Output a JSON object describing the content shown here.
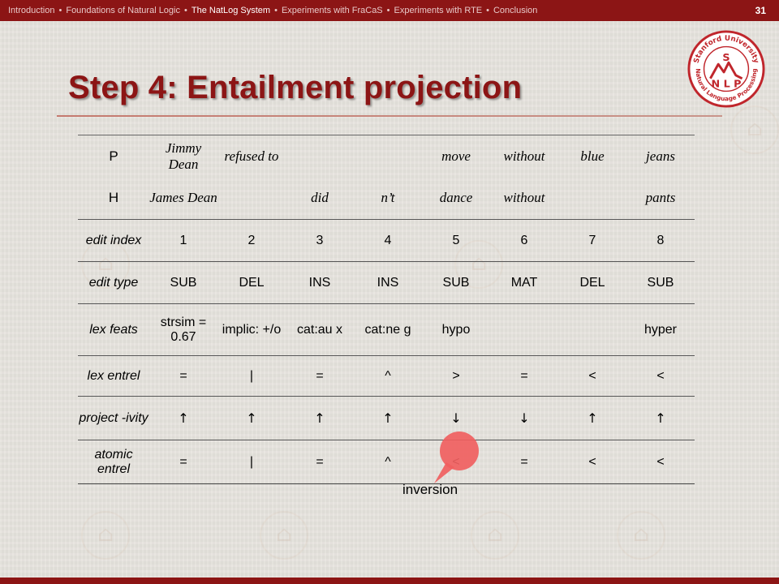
{
  "nav": {
    "items": [
      {
        "label": "Introduction",
        "active": false
      },
      {
        "label": "Foundations of Natural Logic",
        "active": false
      },
      {
        "label": "The NatLog System",
        "active": true
      },
      {
        "label": "Experiments with FraCaS",
        "active": false
      },
      {
        "label": "Experiments with RTE",
        "active": false
      },
      {
        "label": "Conclusion",
        "active": false
      }
    ],
    "separator": "•"
  },
  "page_number": "31",
  "logo": {
    "text_top": "Stanford University",
    "text_bottom": "Natural Language Processing",
    "letter_s": "S",
    "letters": "N L P",
    "color": "#c0262c"
  },
  "title": "Step 4: Entailment projection",
  "table": {
    "rows": [
      {
        "label": "P",
        "type": "word",
        "cells": [
          "Jimmy Dean",
          "refused to",
          "",
          "",
          "move",
          "without",
          "blue",
          "jeans"
        ]
      },
      {
        "label": "H",
        "type": "word",
        "cells": [
          "James Dean",
          "",
          "did",
          "n’t",
          "dance",
          "without",
          "",
          "pants"
        ]
      },
      {
        "label": "edit index",
        "type": "plain",
        "cells": [
          "1",
          "2",
          "3",
          "4",
          "5",
          "6",
          "7",
          "8"
        ]
      },
      {
        "label": "edit type",
        "type": "plain",
        "cells": [
          "SUB",
          "DEL",
          "INS",
          "INS",
          "SUB",
          "MAT",
          "DEL",
          "SUB"
        ]
      },
      {
        "label": "lex feats",
        "type": "plain",
        "cells": [
          "strsim = 0.67",
          "implic: +/o",
          "cat:au x",
          "cat:ne g",
          "hypo",
          "",
          "",
          "hyper"
        ]
      },
      {
        "label": "lex entrel",
        "type": "plain",
        "cells": [
          "=",
          "|",
          "=",
          "^",
          ">",
          "=",
          "<",
          "<"
        ]
      },
      {
        "label": "project -ivity",
        "type": "arrow",
        "cells": [
          "↑",
          "↑",
          "↑",
          "↑",
          "↓",
          "↓",
          "↑",
          "↑"
        ]
      },
      {
        "label": "atomic entrel",
        "type": "plain",
        "cells": [
          "=",
          "|",
          "=",
          "^",
          "<",
          "=",
          "<",
          "<"
        ]
      }
    ]
  },
  "callout": {
    "label": "inversion",
    "color": "#f06060"
  },
  "colors": {
    "accent": "#8c1515",
    "background": "#e6e3dd"
  }
}
